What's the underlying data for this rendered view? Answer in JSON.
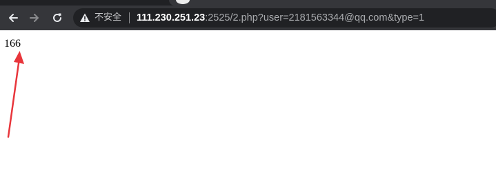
{
  "browser": {
    "back_icon": "arrow-left-icon",
    "forward_icon": "arrow-right-icon",
    "reload_icon": "reload-icon",
    "security_icon": "warning-triangle-icon",
    "security_label": "不安全",
    "url_host": "111.230.251.23",
    "url_rest": ":2525/2.php?user=2181563344@qq.com&type=1"
  },
  "page": {
    "body_text": "166"
  },
  "annotation": {
    "arrow_color": "#e8353b"
  },
  "colors": {
    "toolbar": "#35363a",
    "omnibox": "#202124",
    "url_host": "#ffffff",
    "url_rest": "#a9abae"
  }
}
